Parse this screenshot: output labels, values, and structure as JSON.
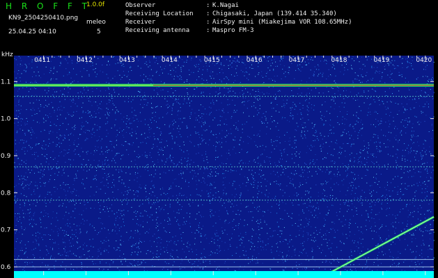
{
  "header": {
    "app_title": "H R O F F T",
    "version": "1.0.0f",
    "file_name": "KN9_2504250410.png",
    "timestamp": "25.04.25 04:10",
    "meleo_label": "meleo",
    "meleo_value": "5",
    "info": [
      {
        "key": "Observer",
        "value": "K.Nagai"
      },
      {
        "key": "Receiving Location",
        "value": "Chigasaki, Japan (139.414 35.340)"
      },
      {
        "key": "Receiver",
        "value": "AirSpy mini (Miakejima VOR 108.65MHz)"
      },
      {
        "key": "Receiving antenna",
        "value": "Maspro FM-3"
      }
    ],
    "separator": ":"
  },
  "colors": {
    "background": "#000000",
    "title_green": "#19e019",
    "version_yellow": "#e6e600",
    "spectrogram_base": "#0a1a88",
    "noise_bright": "#1e8cf0",
    "signal_green": "#22dd66",
    "signal_red": "#ff3322",
    "floor_cyan": "#00ffff"
  },
  "chart_data": {
    "type": "heatmap",
    "ylabel": "kHz",
    "yticks": [
      "0.6",
      "0.7",
      "0.8",
      "0.9",
      "1.0",
      "1.1"
    ],
    "ylim": [
      0.57,
      1.17
    ],
    "xticks": [
      "0411",
      "0412",
      "0413",
      "0414",
      "0415",
      "0416",
      "0417",
      "0418",
      "0419",
      "0420"
    ],
    "xlim": [
      410.3,
      420.2
    ],
    "carrier_khz": 1.09,
    "horizontal_lines_khz": [
      1.06,
      0.87,
      0.78,
      0.62,
      0.6
    ],
    "meteor_trace": {
      "start": [
        417.6,
        0.575
      ],
      "end": [
        420.2,
        0.735
      ]
    }
  }
}
